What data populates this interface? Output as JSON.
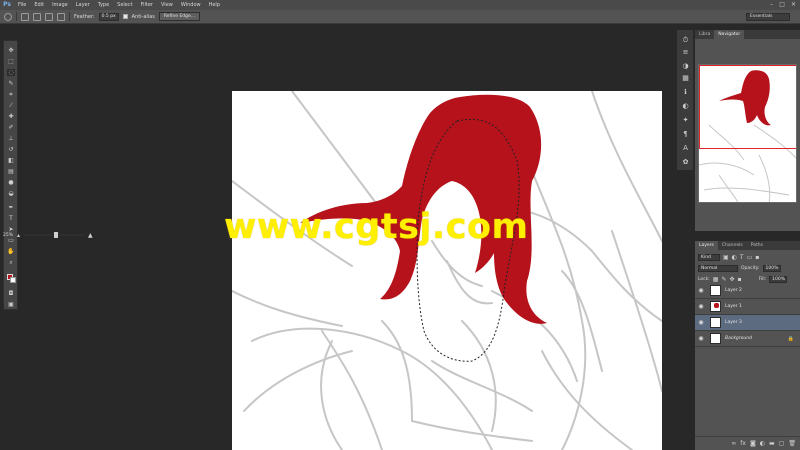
{
  "app": {
    "logo": "Ps"
  },
  "menu": [
    "File",
    "Edit",
    "Image",
    "Layer",
    "Type",
    "Select",
    "Filter",
    "View",
    "Window",
    "Help"
  ],
  "window_controls": [
    "–",
    "□",
    "✕"
  ],
  "options_bar": {
    "feather_label": "Feather:",
    "feather_value": "0.5 px",
    "antialias_label": "Anti-alias",
    "refine_edge_label": "Refine Edge...",
    "workspace": "Essentials"
  },
  "panels": {
    "top_tabs": [
      "Libra",
      "Navigator"
    ],
    "zoom": "25%",
    "layers_tabs": [
      "Layers",
      "Channels",
      "Paths"
    ],
    "kind_label": "Kind",
    "blend_mode": "Normal",
    "opacity_label": "Opacity:",
    "opacity_value": "100%",
    "lock_label": "Lock:",
    "fill_label": "Fill:",
    "fill_value": "100%"
  },
  "layers": [
    {
      "name": "Layer 2",
      "selected": false
    },
    {
      "name": "Layer 1",
      "selected": false
    },
    {
      "name": "Layer 3",
      "selected": true
    },
    {
      "name": "Background",
      "selected": false
    }
  ],
  "watermark": "www.cgtsj.com",
  "colors": {
    "foreground": "#b5121b",
    "background": "#ffffff",
    "accent_red": "#b5121b"
  },
  "icons": {
    "tools": [
      "move-tool",
      "marquee-tool",
      "lasso-tool",
      "quick-select-tool",
      "crop-tool",
      "eyedropper-tool",
      "healing-brush-tool",
      "brush-tool",
      "clone-stamp-tool",
      "history-brush-tool",
      "eraser-tool",
      "gradient-tool",
      "blur-tool",
      "dodge-tool",
      "pen-tool",
      "type-tool",
      "path-select-tool",
      "shape-tool",
      "hand-tool",
      "zoom-tool"
    ]
  }
}
